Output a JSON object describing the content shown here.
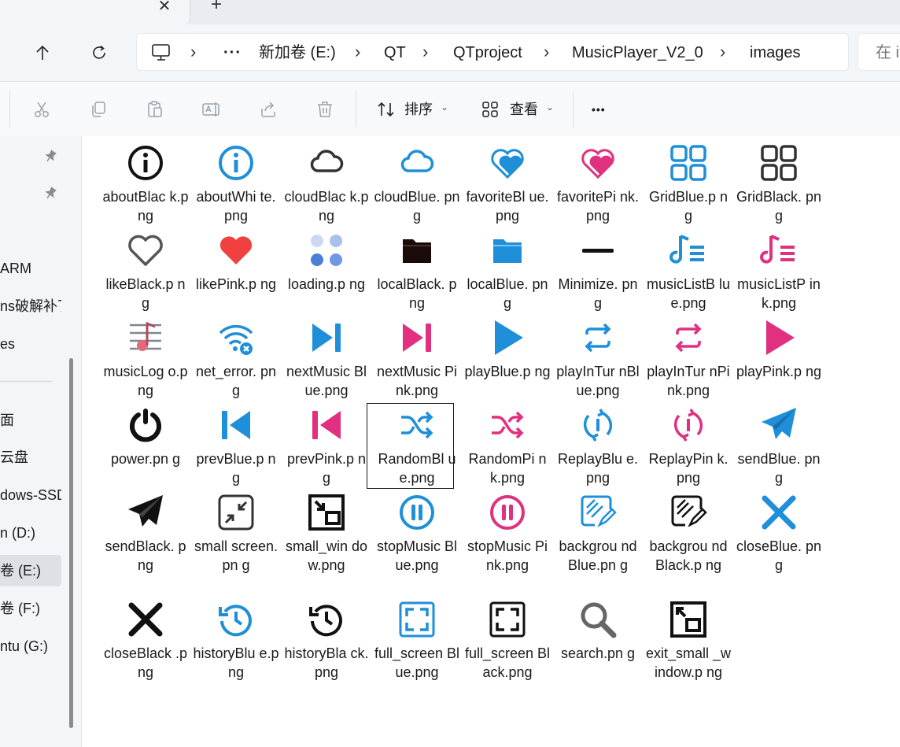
{
  "tabs": {
    "close_symbol": "✕",
    "new_tab_symbol": "+"
  },
  "address": {
    "more_symbol": "···",
    "crumbs": [
      "新加卷 (E:)",
      "QT",
      "QTproject",
      "MusicPlayer_V2_0",
      "images"
    ],
    "search_placeholder": "在 i"
  },
  "toolbar": {
    "sort_label": "排序",
    "view_label": "查看",
    "more_symbol": "•••"
  },
  "sidebar": {
    "items": [
      "ARM",
      "ns破解补丁",
      "es",
      "面",
      "云盘",
      "dows-SSD",
      "n (D:)",
      "卷 (E:)",
      "卷 (F:)",
      "ntu (G:)"
    ]
  },
  "files": [
    {
      "name": "aboutBlac k.png",
      "icon": "info-black-icon"
    },
    {
      "name": "aboutWhi te.png",
      "icon": "info-blue-icon"
    },
    {
      "name": "cloudBlac k.png",
      "icon": "cloud-black-icon"
    },
    {
      "name": "cloudBlue. png",
      "icon": "cloud-blue-icon"
    },
    {
      "name": "favoriteBl ue.png",
      "icon": "heart-blue-icon"
    },
    {
      "name": "favoritePi nk.png",
      "icon": "heart-pink-icon"
    },
    {
      "name": "GridBlue.p ng",
      "icon": "grid-blue-icon"
    },
    {
      "name": "GridBlack. png",
      "icon": "grid-black-icon"
    },
    {
      "name": "likeBlack.p ng",
      "icon": "heart-outline-icon"
    },
    {
      "name": "likePink.p ng",
      "icon": "heart-red-icon"
    },
    {
      "name": "loading.p ng",
      "icon": "loading-dots-icon"
    },
    {
      "name": "localBlack. png",
      "icon": "folder-black-icon"
    },
    {
      "name": "localBlue. png",
      "icon": "folder-blue-icon"
    },
    {
      "name": "Minimize. png",
      "icon": "minimize-icon"
    },
    {
      "name": "musicListB lue.png",
      "icon": "music-list-blue-icon"
    },
    {
      "name": "musicListP ink.png",
      "icon": "music-list-pink-icon"
    },
    {
      "name": "musicLog o.png",
      "icon": "music-logo-icon"
    },
    {
      "name": "net_error. png",
      "icon": "wifi-error-icon"
    },
    {
      "name": "nextMusic Blue.png",
      "icon": "next-blue-icon"
    },
    {
      "name": "nextMusic Pink.png",
      "icon": "next-pink-icon"
    },
    {
      "name": "playBlue.p ng",
      "icon": "play-blue-icon"
    },
    {
      "name": "playInTur nBlue.png",
      "icon": "repeat-blue-icon"
    },
    {
      "name": "playInTur nPink.png",
      "icon": "repeat-pink-icon"
    },
    {
      "name": "playPink.p ng",
      "icon": "play-pink-icon"
    },
    {
      "name": "power.pn g",
      "icon": "power-icon"
    },
    {
      "name": "prevBlue.p ng",
      "icon": "prev-blue-icon"
    },
    {
      "name": "prevPink.p ng",
      "icon": "prev-pink-icon"
    },
    {
      "name": "RandomBl ue.png",
      "icon": "shuffle-blue-icon",
      "selected": true
    },
    {
      "name": "RandomPi nk.png",
      "icon": "shuffle-pink-icon"
    },
    {
      "name": "ReplayBlu e.png",
      "icon": "replay-blue-icon"
    },
    {
      "name": "ReplayPin k.png",
      "icon": "replay-pink-icon"
    },
    {
      "name": "sendBlue. png",
      "icon": "send-blue-icon"
    },
    {
      "name": "sendBlack. png",
      "icon": "send-black-icon"
    },
    {
      "name": "small screen.pn g",
      "icon": "small-screen-icon"
    },
    {
      "name": "small_win dow.png",
      "icon": "small-window-icon"
    },
    {
      "name": "stopMusic Blue.png",
      "icon": "pause-blue-icon"
    },
    {
      "name": "stopMusic Pink.png",
      "icon": "pause-pink-icon"
    },
    {
      "name": "backgrou ndBlue.pn g",
      "icon": "background-blue-icon"
    },
    {
      "name": "backgrou ndBlack.p ng",
      "icon": "background-black-icon"
    },
    {
      "name": "closeBlue. png",
      "icon": "close-blue-icon"
    },
    {
      "name": "closeBlack .png",
      "icon": "close-black-icon"
    },
    {
      "name": "historyBlu e.png",
      "icon": "history-blue-icon"
    },
    {
      "name": "historyBla ck.png",
      "icon": "history-black-icon"
    },
    {
      "name": "full_screen Blue.png",
      "icon": "fullscreen-blue-icon"
    },
    {
      "name": "full_screen Black.png",
      "icon": "fullscreen-black-icon"
    },
    {
      "name": "search.pn g",
      "icon": "search-gray-icon"
    },
    {
      "name": "exit_small _window.p ng",
      "icon": "exit-small-window-icon"
    }
  ],
  "colors": {
    "blue": "#1e8fd8",
    "pink": "#e0307f",
    "black": "#111111",
    "red": "#f0403f"
  }
}
